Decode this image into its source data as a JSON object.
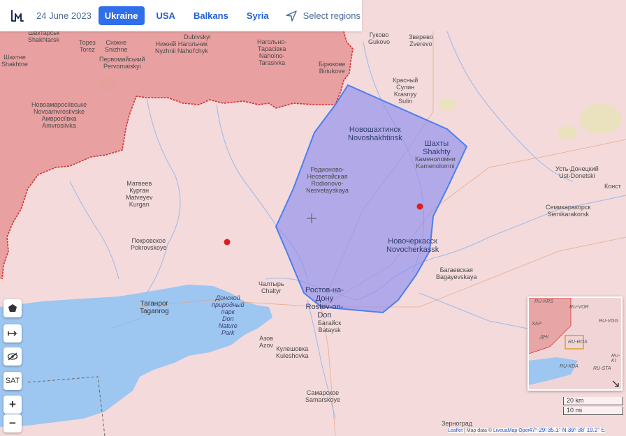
{
  "topbar": {
    "date": "24 June 2023",
    "tabs": [
      {
        "label": "Ukraine",
        "active": true
      },
      {
        "label": "USA",
        "active": false
      },
      {
        "label": "Balkans",
        "active": false
      },
      {
        "label": "Syria",
        "active": false
      }
    ],
    "select_regions": "Select regions"
  },
  "colors": {
    "occupied": "#e58f8f",
    "territory": "#f3d9da",
    "sea": "#9cc5f0",
    "polygon_fill": "#8f8ff0",
    "polygon_stroke": "#4d7fee",
    "frontline": "#d63333",
    "marker": "#dd1e1e",
    "accent": "#2f6fea"
  },
  "controls": {
    "layers": "layers-icon",
    "toggle": "arrows-icon",
    "hide": "eye-slash-icon",
    "sat": "SAT",
    "zoom_in": "+",
    "zoom_out": "−"
  },
  "labels": {
    "shakhtarsk": "Шахтарськ\nShakhtarsk",
    "torez": "Торез\nTorez",
    "snizhne": "Сніжне\nSnizhne",
    "pervomaiskyi": "Первомайський\nPervomaiskyi",
    "dubivskyi": "Dubivskyi",
    "nyzhnii": "Нижній Нагольчик\nNyzhnii Nahol'chyk",
    "nahol_tarasivka": "Нагольно-\nТарасівка\nNaholno-\nTarasivka",
    "biriukove": "Бірюкове\nBiriukove",
    "shakhtne": "Шахтне\nShakhtne",
    "novoamvrosiivske": "Новоамвросіївське\nNovoamvrosiivske\nАмвросіївка\nAmvrosiivka",
    "gukovo": "Гуково\nGukovo",
    "zverevo": "Зверево\nZverevo",
    "krasny_sulin": "Красный\nСулин\nKrasnyy\nSulin",
    "novoshakhtinsk": "Новошахтинск\nNovoshakhtinsk",
    "shakhty": "Шахты\nShakhty",
    "kamenolomni": "Каменоломни\nKamenolomni",
    "ust_donetski": "Усть-Донецкий\nUst-Donetski",
    "konst": "Конст",
    "rodionovo": "Родионово-\nНесветайская\nRodionovo-\nNesvetayskaya",
    "matveev_kurgan": "Матвеев\nКурган\nMatveyev\nKurgan",
    "semikarakorsk": "Семикаракорск\nSemikarakorsk",
    "pokrovskoye": "Покровское\nPokrovskoye",
    "novocherkassk": "Новочеркасск\nNovocherkassk",
    "bagaevskaya": "Багаевская\nBagayevskaya",
    "chaltyr": "Чалтырь\nChaltyr",
    "rostov": "Ростов-на-\nДону\nRostov-on-\nDon",
    "bataysk": "Батайск\nBataysk",
    "taganrog": "Таганрог\nTaganrog",
    "don_park": "Донской\nприродный\nпарк\nDon\nNature\nPark",
    "azov": "Азов\nAzov",
    "kuleshovka": "Кулешовка\nKuleshovka",
    "samarskoye": "Самарское\nSamarskoye",
    "zernograd": "Зерноград"
  },
  "minimap": {
    "labels": [
      "RU-KRS",
      "RU-VOR",
      "ХАР",
      "RU-VGG",
      "ДНІ",
      "RU-ROS",
      "RU-KDA",
      "RU-STA",
      "RU-KI"
    ]
  },
  "scale": {
    "km": "20 km",
    "mi": "10 mi"
  },
  "coordinates": "47° 29' 35.1'' N 39° 38' 19.2'' E",
  "attribution": {
    "leaflet": "Leaflet",
    "text": " | Map data © ",
    "liveuamap": "LiveuaMap",
    "osm": "OpenStreetMap",
    "tail": " contributors"
  }
}
